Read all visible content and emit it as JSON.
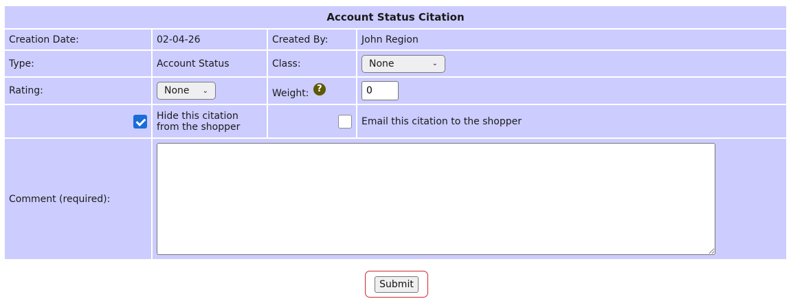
{
  "form": {
    "title": "Account Status Citation",
    "creation_date_label": "Creation Date:",
    "creation_date_value": "02-04-26",
    "created_by_label": "Created By:",
    "created_by_value": "John Region",
    "type_label": "Type:",
    "type_value": "Account Status",
    "class_label": "Class:",
    "class_selected": "None",
    "rating_label": "Rating:",
    "rating_selected": "None",
    "weight_label": "Weight:",
    "weight_value": "0",
    "hide_label": "Hide this citation from the shopper",
    "hide_checked": true,
    "email_label": "Email this citation to the shopper",
    "email_checked": false,
    "comment_label": "Comment (required):",
    "comment_value": "",
    "submit_label": "Submit"
  },
  "icons": {
    "help": "question-mark-circle",
    "dropdown": "chevron-down",
    "checkbox_checked": "checkmark"
  },
  "colors": {
    "cell_background": "#ccccff",
    "checkbox_checked": "#1a6dd6",
    "submit_highlight": "#d0262b",
    "help_icon": "#5e5a00"
  }
}
